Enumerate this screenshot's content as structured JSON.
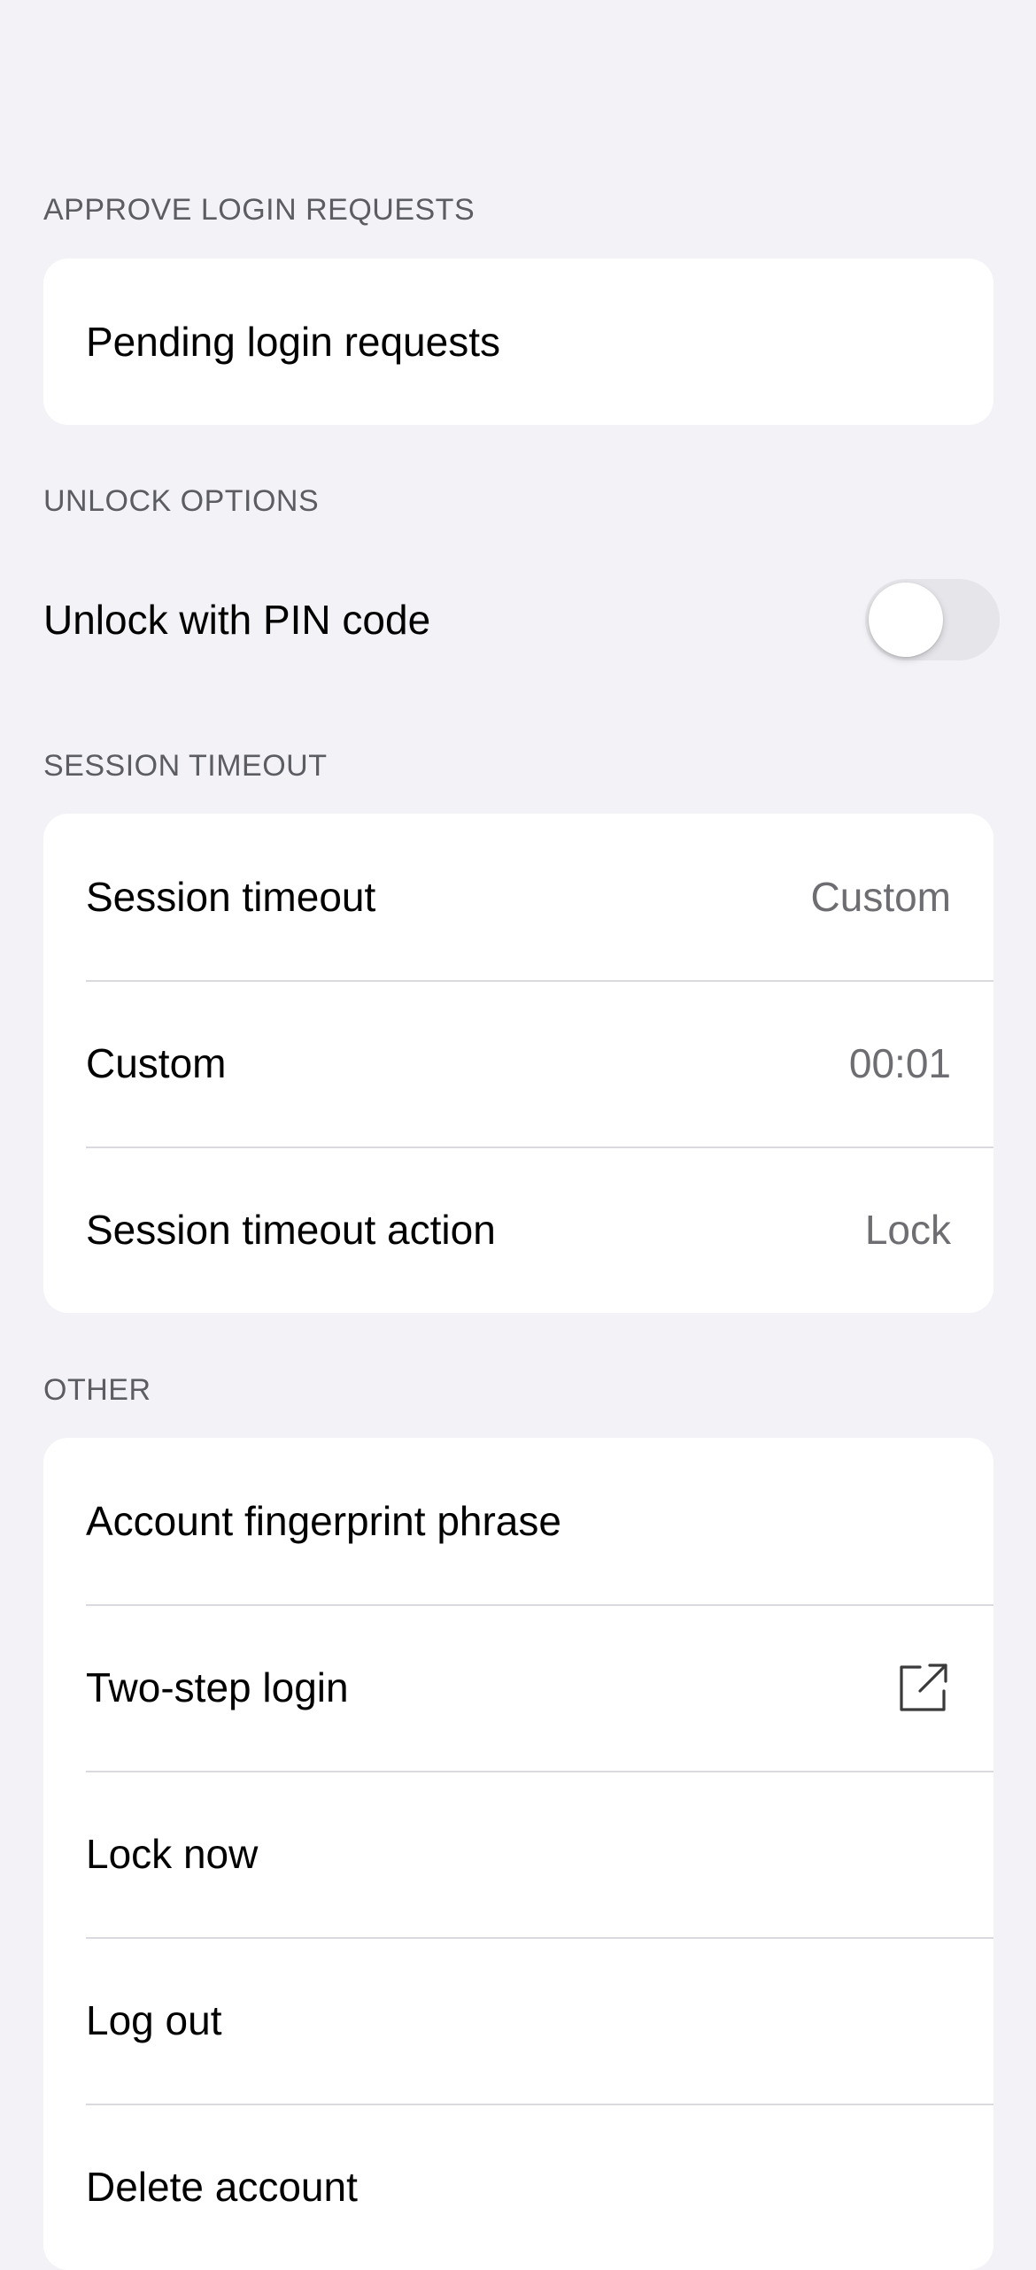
{
  "colors": {
    "background": "#f2f2f7",
    "card": "#ffffff",
    "section_header": "#5c5c63",
    "secondary_value": "#6d6d72",
    "separator": "#d9d9de",
    "toggle_off": "#e5e5ea"
  },
  "sections": {
    "approve_login": {
      "header": "APPROVE LOGIN REQUESTS",
      "pending_label": "Pending login requests"
    },
    "unlock": {
      "header": "UNLOCK OPTIONS",
      "pin_label": "Unlock with PIN code",
      "pin_enabled": false
    },
    "session_timeout": {
      "header": "SESSION TIMEOUT",
      "timeout_label": "Session timeout",
      "timeout_value": "Custom",
      "custom_label": "Custom",
      "custom_value": "00:01",
      "action_label": "Session timeout action",
      "action_value": "Lock"
    },
    "other": {
      "header": "OTHER",
      "fingerprint_label": "Account fingerprint phrase",
      "two_step_label": "Two-step login",
      "two_step_icon": "external-link-icon",
      "lock_now_label": "Lock now",
      "log_out_label": "Log out",
      "delete_label": "Delete account"
    }
  }
}
